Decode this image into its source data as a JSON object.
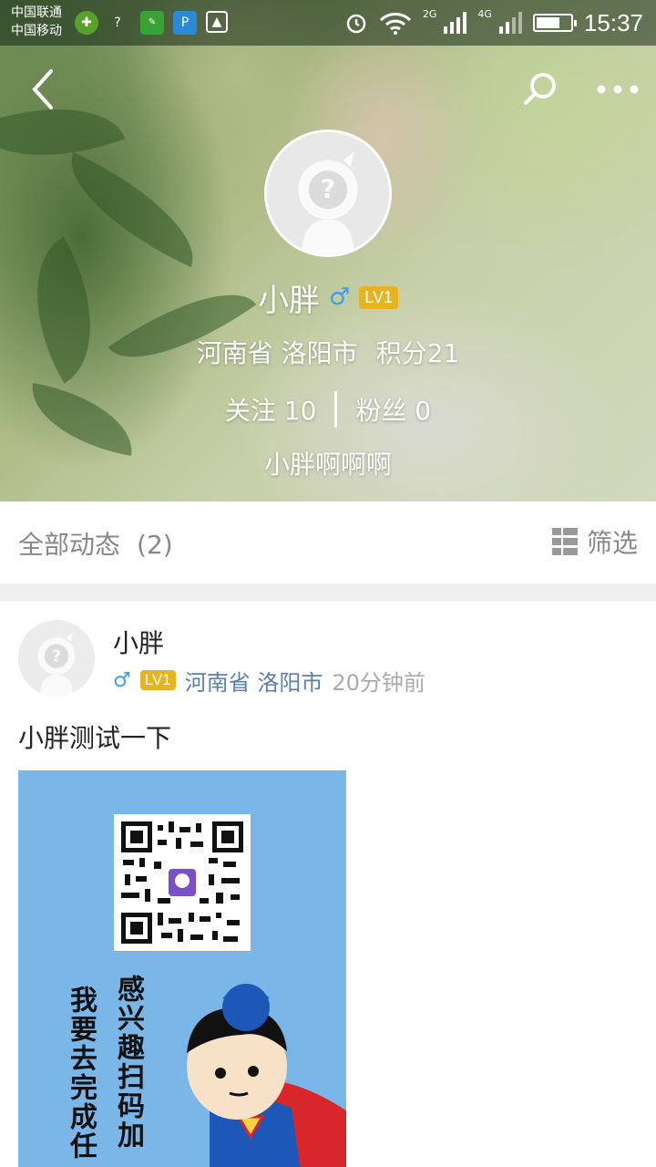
{
  "status_bar": {
    "carrier_1": "中国联通",
    "carrier_2": "中国移动",
    "net_2g": "2G",
    "net_4g": "4G",
    "time": "15:37"
  },
  "profile": {
    "name": "小胖",
    "gender_symbol": "♂",
    "level": "LV1",
    "location": "河南省 洛阳市",
    "points": "积分21",
    "following": "关注 10",
    "fans": "粉丝 0",
    "signature": "小胖啊啊啊"
  },
  "filter_bar": {
    "title": "全部动态",
    "count": "(2)",
    "filter_label": "筛选"
  },
  "post": {
    "author": "小胖",
    "gender_symbol": "♂",
    "level": "LV1",
    "location": "河南省 洛阳市",
    "time": "20分钟前",
    "text": "小胖测试一下",
    "image_text_left": "我要去完成任",
    "image_text_right": "感兴趣扫码加"
  },
  "colors": {
    "accent_blue": "#3f9ee8",
    "level_badge": "#e6b422",
    "location_link": "#5b7fa8",
    "image_bg": "#7ab6e8"
  },
  "icons": [
    "back-arrow-icon",
    "search-icon",
    "more-icon",
    "filter-grid-icon",
    "alarm-icon",
    "wifi-icon",
    "signal-icon",
    "battery-icon"
  ]
}
